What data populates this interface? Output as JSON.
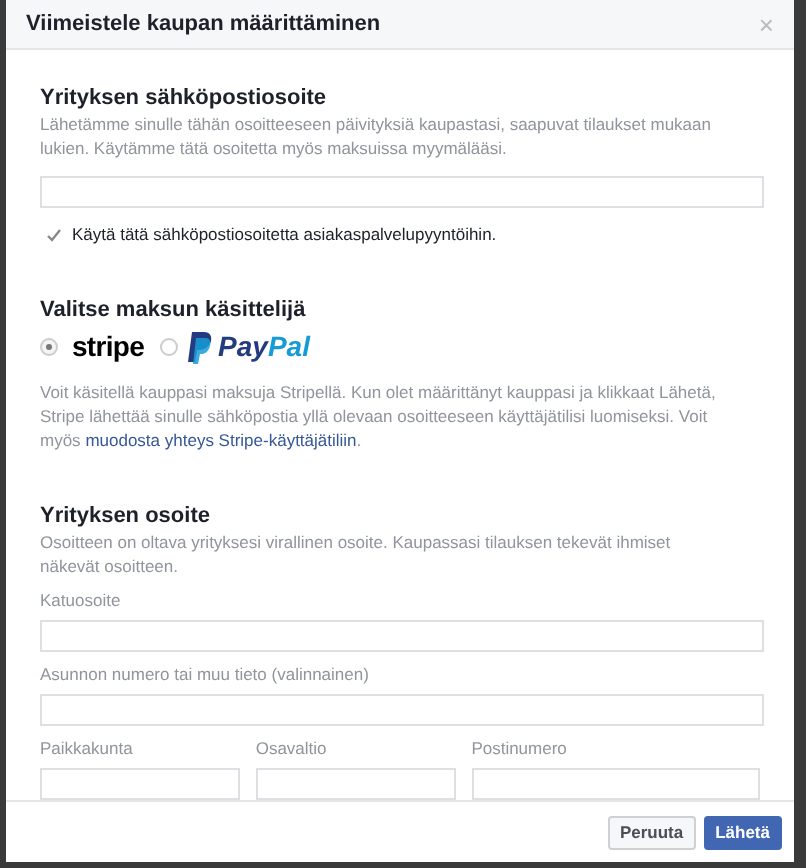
{
  "dialog": {
    "title": "Viimeistele kaupan määrittäminen",
    "close": "×"
  },
  "email_section": {
    "heading": "Yrityksen sähköpostiosoite",
    "description": "Lähetämme sinulle tähän osoitteeseen päivityksiä kaupastasi, saapuvat tilaukset mukaan lukien. Käytämme tätä osoitetta myös maksuissa myymälääsi.",
    "checkbox": {
      "label": "Käytä tätä sähköpostiosoitetta asiakaspalvelupyyntöihin.",
      "checked": true
    }
  },
  "payment_section": {
    "heading": "Valitse maksun käsittelijä",
    "options": [
      {
        "kind": "stripe",
        "label": "stripe",
        "selected": true
      },
      {
        "kind": "paypal",
        "label": "Pay",
        "label_2": "Pal",
        "selected": false
      }
    ],
    "description": "Voit käsitellä kauppasi maksuja Stripellä. Kun olet määrittänyt kauppasi ja klikkaat Lähetä, Stripe lähettää sinulle sähköpostia yllä olevaan osoitteeseen käyttäjätilisi luomiseksi. Voit myös",
    "link": "muodosta yhteys Stripe-käyttäjätiliin",
    "after_link": "."
  },
  "address_section": {
    "heading": "Yrityksen osoite",
    "description": "Osoitteen on oltava yrityksesi virallinen osoite. Kaupassasi tilauksen tekevät ihmiset näkevät osoitteen.",
    "fields": [
      {
        "label": "Katuosoite"
      },
      {
        "label": "Asunnon numero tai muu tieto (valinnainen)"
      }
    ],
    "row_fields": [
      {
        "label": "Paikkakunta"
      },
      {
        "label": "Osavaltio"
      },
      {
        "label": "Postinumero"
      }
    ]
  },
  "buttons": [
    {
      "kind": "secondary",
      "label": "Peruuta"
    },
    {
      "kind": "primary",
      "label": "Lähetä"
    }
  ]
}
